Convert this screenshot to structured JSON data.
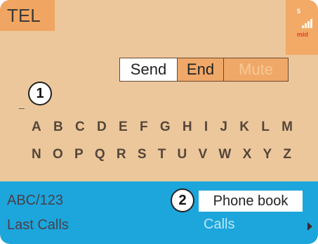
{
  "header": {
    "title": "TEL"
  },
  "status": {
    "signal_label": "5",
    "network_label": "mid"
  },
  "softkeys": {
    "send": "Send",
    "end": "End",
    "mute": "Mute"
  },
  "cursor": "_",
  "callouts": {
    "first": "1",
    "second": "2"
  },
  "alphabet": {
    "row1": [
      "A",
      "B",
      "C",
      "D",
      "E",
      "F",
      "G",
      "H",
      "I",
      "J",
      "K",
      "L",
      "M"
    ],
    "row2": [
      "N",
      "O",
      "P",
      "Q",
      "R",
      "S",
      "T",
      "U",
      "V",
      "W",
      "X",
      "Y",
      "Z"
    ]
  },
  "bottom": {
    "input_mode": "ABC/123",
    "last_calls": "Last Calls",
    "phone_book": "Phone book",
    "calls": "Calls"
  },
  "colors": {
    "screen_bg": "#ecc79b",
    "accent_orange": "#f0a662",
    "bottom_bar": "#1ca6dc"
  }
}
